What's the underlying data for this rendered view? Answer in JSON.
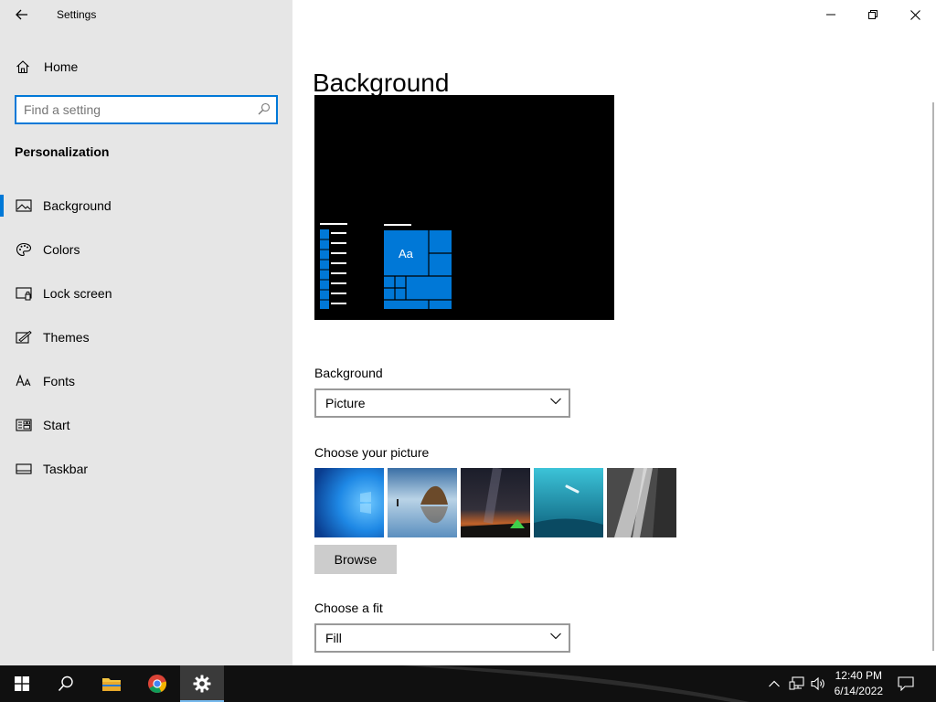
{
  "window": {
    "title": "Settings"
  },
  "sidebar": {
    "home_label": "Home",
    "search_placeholder": "Find a setting",
    "section_title": "Personalization",
    "items": [
      {
        "label": "Background",
        "icon": "picture-icon",
        "selected": true
      },
      {
        "label": "Colors",
        "icon": "palette-icon",
        "selected": false
      },
      {
        "label": "Lock screen",
        "icon": "lock-screen-icon",
        "selected": false
      },
      {
        "label": "Themes",
        "icon": "themes-icon",
        "selected": false
      },
      {
        "label": "Fonts",
        "icon": "fonts-icon",
        "selected": false
      },
      {
        "label": "Start",
        "icon": "start-layout-icon",
        "selected": false
      },
      {
        "label": "Taskbar",
        "icon": "taskbar-icon",
        "selected": false
      }
    ]
  },
  "main": {
    "page_title": "Background",
    "preview": {
      "tile_text": "Aa"
    },
    "background_field": {
      "label": "Background",
      "value": "Picture"
    },
    "picture_field": {
      "label": "Choose your picture",
      "thumbnails": [
        "windows-blue-wallpaper",
        "beach-rock-reflection",
        "night-sky-tent",
        "underwater-swimmer",
        "rock-cliff-waterfall"
      ],
      "browse_label": "Browse"
    },
    "fit_field": {
      "label": "Choose a fit",
      "value": "Fill"
    }
  },
  "taskbar": {
    "apps": [
      "start-icon",
      "search-icon",
      "file-explorer-icon",
      "chrome-icon",
      "settings-icon"
    ],
    "active_app": "settings-icon",
    "time": "12:40 PM",
    "date": "6/14/2022"
  },
  "colors": {
    "accent": "#0078d7",
    "sidebar_bg": "#e6e6e6",
    "taskbar_bg": "#101010"
  }
}
